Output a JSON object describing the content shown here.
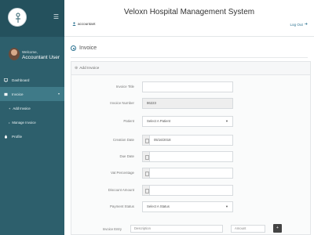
{
  "app": {
    "title": "Veloxn Hospital Management System"
  },
  "header": {
    "account_label": "accountant",
    "logout_label": "Log Out"
  },
  "sidebar": {
    "welcome": "Welcome,",
    "user_name": "Accountant User",
    "items": [
      {
        "label": "Dashboard",
        "icon": "monitor-icon"
      },
      {
        "label": "Invoice",
        "icon": "invoice-icon"
      },
      {
        "label": "Profile",
        "icon": "profile-icon"
      }
    ],
    "invoice_sub": [
      {
        "label": "Add Invoice"
      },
      {
        "label": "Manage Invoice"
      }
    ]
  },
  "page": {
    "heading": "Invoice",
    "panel_title": "Add Invoice"
  },
  "form": {
    "invoice_title": {
      "label": "Invoice Title",
      "value": ""
    },
    "invoice_number": {
      "label": "Invoice Number",
      "value": "86223"
    },
    "patient": {
      "label": "Patient",
      "value": "Select A Patient"
    },
    "creation_date": {
      "label": "Creation Date",
      "value": "05/16/2018"
    },
    "due_date": {
      "label": "Due Date",
      "value": ""
    },
    "vat_percentage": {
      "label": "Vat Percentage",
      "value": ""
    },
    "discount_amount": {
      "label": "Discount Amount",
      "value": ""
    },
    "payment_status": {
      "label": "Payment Status",
      "value": "Select A Status"
    }
  },
  "entries": {
    "label": "Invoice Entry",
    "description_placeholder": "Description",
    "amount_placeholder": "Amount",
    "add_label": "+"
  },
  "colors": {
    "sidebar": "#2d5f6c",
    "sidebar_active": "#3f7a88",
    "accent": "#2a7190"
  }
}
